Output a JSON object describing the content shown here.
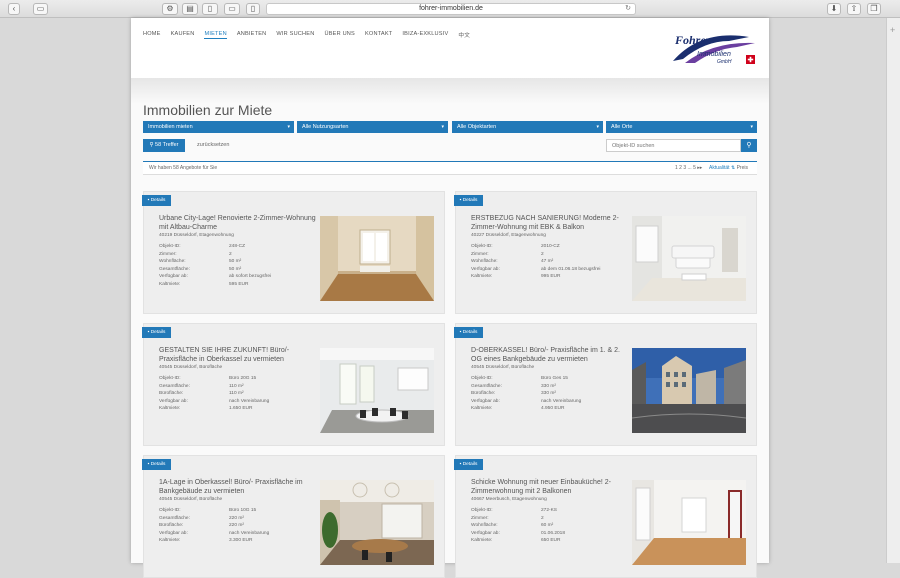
{
  "browser": {
    "url": "fohrer-immobilien.de",
    "reload_glyph": "↻",
    "side_glyph": "+",
    "buttons": [
      "back-arrow-icon",
      "sidebar-icon",
      "share-icon",
      "reading-icon",
      "tabs-icon",
      "phone-icon",
      "download-icon",
      "upload-icon",
      "new-tab-icon"
    ]
  },
  "nav": {
    "items": [
      "HOME",
      "KAUFEN",
      "MIETEN",
      "ANBIETEN",
      "WIR SUCHEN",
      "ÜBER UNS",
      "KONTAKT",
      "IBIZA-EXKLUSIV",
      "中文"
    ],
    "active_index": 2
  },
  "logo": {
    "line1": "Fohrer",
    "line2": "Immobilien",
    "line3": "GmbH"
  },
  "page": {
    "title": "Immobilien zur Miete"
  },
  "filters": {
    "f1": "Immobilien mieten",
    "f2": "Alle Nutzungsarten",
    "f3": "Alle Objektarten",
    "f4": "Alle Orte",
    "caret": "▾"
  },
  "search": {
    "hits_label": "58 Treffer",
    "hits_icon": "search-icon",
    "reset_label": "zurücksetzen",
    "id_placeholder": "Objekt-ID suchen",
    "search_glyph": "⚲"
  },
  "infobar": {
    "text": "Wir haben 58 Angebote für Sie",
    "pager": "1 2 3 ... 5 ▸▸",
    "sort_label": "Aktualität",
    "sort_icon": "sort-icon",
    "sort_alt": "Preis"
  },
  "colors": {
    "accent": "#2279b8",
    "nav_active": "#1f7fbf"
  },
  "listings": [
    {
      "details": "Details",
      "title": "Urbane City-Lage! Renovierte 2-Zimmer-Wohnung mit Altbau-Charme",
      "subtitle": "40219 Düsseldorf, Etagenwohnung",
      "rows": [
        [
          "Objekt-ID:",
          "248-CZ"
        ],
        [
          "Zimmer:",
          "2"
        ],
        [
          "Wohnfläche:",
          "50 m²"
        ],
        [
          "Gesamtfläche:",
          "50 m²"
        ],
        [
          "Verfügbar ab:",
          "ab sofort bezugsfrei"
        ],
        [
          "Kaltmiete:",
          "595 EUR"
        ]
      ]
    },
    {
      "details": "Details",
      "title": "ERSTBEZUG NACH SANIERUNG! Moderne 2-Zimmer-Wohnung mit EBK & Balkon",
      "subtitle": "40227 Düsseldorf, Etagenwohnung",
      "rows": [
        [
          "Objekt-ID:",
          "2010-CZ"
        ],
        [
          "Zimmer:",
          "2"
        ],
        [
          "Wohnfläche:",
          "47 m²"
        ],
        [
          "Verfügbar ab:",
          "ab dem 01.06.18 bezugsfrei"
        ],
        [
          "Kaltmiete:",
          "995 EUR"
        ]
      ]
    },
    {
      "details": "Details",
      "title": "GESTALTEN SIE IHRE ZUKUNFT! Büro/- Praxisfläche in Oberkassel zu vermieten",
      "subtitle": "40545 Düsseldorf, Bürofläche",
      "rows": [
        [
          "Objekt-ID:",
          "Büro 20G 15"
        ],
        [
          "Gesamtfläche:",
          "110 m²"
        ],
        [
          "Bürofläche:",
          "110 m²"
        ],
        [
          "Verfügbar ab:",
          "nach Vereinbarung"
        ],
        [
          "Kaltmiete:",
          "1.650 EUR"
        ]
      ]
    },
    {
      "details": "Details",
      "title": "D-OBERKASSEL! Büro/- Praxisfläche im 1. & 2. OG eines Bankgebäude zu vermieten",
      "subtitle": "40545 Düsseldorf, Bürofläche",
      "rows": [
        [
          "Objekt-ID:",
          "Büro Ges 15"
        ],
        [
          "Gesamtfläche:",
          "330 m²"
        ],
        [
          "Bürofläche:",
          "330 m²"
        ],
        [
          "Verfügbar ab:",
          "nach Vereinbarung"
        ],
        [
          "Kaltmiete:",
          "4.950 EUR"
        ]
      ]
    },
    {
      "details": "Details",
      "title": "1A-Lage in Oberkassel! Büro/- Praxisfläche im Bankgebäude zu vermieten",
      "subtitle": "40545 Düsseldorf, Bürofläche",
      "rows": [
        [
          "Objekt-ID:",
          "Büro 10G 15"
        ],
        [
          "Gesamtfläche:",
          "220 m²"
        ],
        [
          "Bürofläche:",
          "220 m²"
        ],
        [
          "Verfügbar ab:",
          "nach Vereinbarung"
        ],
        [
          "Kaltmiete:",
          "3.300 EUR"
        ]
      ]
    },
    {
      "details": "Details",
      "title": "Schicke Wohnung mit neuer Einbauküche! 2-Zimmerwohnung mit 2 Balkonen",
      "subtitle": "40667 Meerbusch, Etagenwohnung",
      "rows": [
        [
          "Objekt-ID:",
          "272-KS"
        ],
        [
          "Zimmer:",
          "2"
        ],
        [
          "Wohnfläche:",
          "60 m²"
        ],
        [
          "Verfügbar ab:",
          "01.06.2018"
        ],
        [
          "Kaltmiete:",
          "650 EUR"
        ]
      ]
    }
  ]
}
